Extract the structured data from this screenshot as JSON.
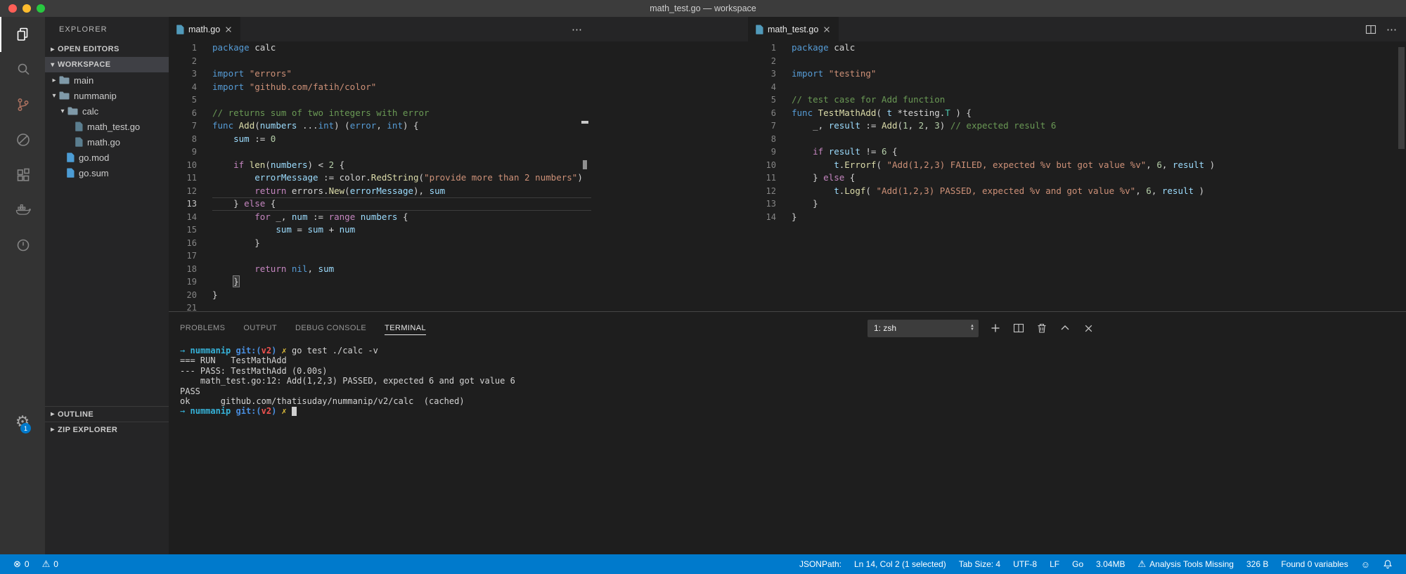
{
  "window": {
    "title": "math_test.go — workspace"
  },
  "colors": {
    "accent": "#007acc",
    "statusbar_bg": "#007acc",
    "badge_bg": "#007acc",
    "editor_bg": "#1e1e1e",
    "sidebar_bg": "#252526",
    "activitybar_bg": "#333333",
    "titlebar_bg": "#3c3c3c"
  },
  "activity_bar": {
    "items": [
      {
        "name": "explorer",
        "active": true
      },
      {
        "name": "search",
        "active": false
      },
      {
        "name": "source-control",
        "active": false,
        "tint": "#a9705f"
      },
      {
        "name": "circle-slash",
        "active": false
      },
      {
        "name": "extensions",
        "active": false
      },
      {
        "name": "docker",
        "active": false
      },
      {
        "name": "power-circle",
        "active": false
      }
    ],
    "settings_badge": "1"
  },
  "sidebar": {
    "title": "EXPLORER",
    "sections_top": [
      {
        "label": "OPEN EDITORS",
        "expanded": false,
        "selected": false
      },
      {
        "label": "WORKSPACE",
        "expanded": true,
        "selected": true
      }
    ],
    "tree": [
      {
        "label": "main",
        "kind": "folder",
        "level": 0,
        "expanded": false
      },
      {
        "label": "nummanip",
        "kind": "folder",
        "level": 0,
        "expanded": true
      },
      {
        "label": "calc",
        "kind": "folder",
        "level": 1,
        "expanded": true
      },
      {
        "label": "math_test.go",
        "kind": "file",
        "icon": "go-file",
        "level": 2
      },
      {
        "label": "math.go",
        "kind": "file",
        "icon": "go-file",
        "level": 2
      },
      {
        "label": "go.mod",
        "kind": "file",
        "icon": "mod-file",
        "level": 1
      },
      {
        "label": "go.sum",
        "kind": "file",
        "icon": "mod-file",
        "level": 1
      }
    ],
    "sections_bottom": [
      {
        "label": "OUTLINE"
      },
      {
        "label": "ZIP EXPLORER"
      }
    ]
  },
  "editors": {
    "left": {
      "tab": "math.go",
      "current_line": 13,
      "lines": [
        [
          [
            "k",
            "package"
          ],
          [
            "p",
            " calc"
          ]
        ],
        [],
        [
          [
            "k",
            "import"
          ],
          [
            "p",
            " "
          ],
          [
            "s",
            "\"errors\""
          ]
        ],
        [
          [
            "k",
            "import"
          ],
          [
            "p",
            " "
          ],
          [
            "s",
            "\"github.com/fatih/color\""
          ]
        ],
        [],
        [
          [
            "m",
            "// returns sum of two integers with error"
          ]
        ],
        [
          [
            "k",
            "func"
          ],
          [
            "p",
            " "
          ],
          [
            "f",
            "Add"
          ],
          [
            "p",
            "("
          ],
          [
            "v",
            "numbers"
          ],
          [
            "p",
            " ..."
          ],
          [
            "k",
            "int"
          ],
          [
            "p",
            ") ("
          ],
          [
            "k",
            "error"
          ],
          [
            "p",
            ", "
          ],
          [
            "k",
            "int"
          ],
          [
            "p",
            ") {"
          ]
        ],
        [
          [
            "p",
            "    "
          ],
          [
            "v",
            "sum"
          ],
          [
            "p",
            " := "
          ],
          [
            "n",
            "0"
          ]
        ],
        [],
        [
          [
            "p",
            "    "
          ],
          [
            "c",
            "if"
          ],
          [
            "p",
            " "
          ],
          [
            "f",
            "len"
          ],
          [
            "p",
            "("
          ],
          [
            "v",
            "numbers"
          ],
          [
            "p",
            ") < "
          ],
          [
            "n",
            "2"
          ],
          [
            "p",
            " {"
          ]
        ],
        [
          [
            "p",
            "        "
          ],
          [
            "v",
            "errorMessage"
          ],
          [
            "p",
            " := color."
          ],
          [
            "f",
            "RedString"
          ],
          [
            "p",
            "("
          ],
          [
            "s",
            "\"provide more than 2 numbers\""
          ],
          [
            "p",
            ")"
          ]
        ],
        [
          [
            "p",
            "        "
          ],
          [
            "c",
            "return"
          ],
          [
            "p",
            " errors."
          ],
          [
            "f",
            "New"
          ],
          [
            "p",
            "("
          ],
          [
            "v",
            "errorMessage"
          ],
          [
            "p",
            "), "
          ],
          [
            "v",
            "sum"
          ]
        ],
        [
          [
            "p",
            "    } "
          ],
          [
            "c",
            "else"
          ],
          [
            "p",
            " {"
          ]
        ],
        [
          [
            "p",
            "        "
          ],
          [
            "c",
            "for"
          ],
          [
            "p",
            " _, "
          ],
          [
            "v",
            "num"
          ],
          [
            "p",
            " := "
          ],
          [
            "c",
            "range"
          ],
          [
            "p",
            " "
          ],
          [
            "v",
            "numbers"
          ],
          [
            "p",
            " {"
          ]
        ],
        [
          [
            "p",
            "            "
          ],
          [
            "v",
            "sum"
          ],
          [
            "p",
            " = "
          ],
          [
            "v",
            "sum"
          ],
          [
            "p",
            " + "
          ],
          [
            "v",
            "num"
          ]
        ],
        [
          [
            "p",
            "        }"
          ]
        ],
        [],
        [
          [
            "p",
            "        "
          ],
          [
            "c",
            "return"
          ],
          [
            "p",
            " "
          ],
          [
            "k",
            "nil"
          ],
          [
            "p",
            ", "
          ],
          [
            "v",
            "sum"
          ]
        ],
        [
          [
            "p",
            "    "
          ],
          [
            "b",
            "}"
          ]
        ],
        [
          [
            "p",
            "}"
          ]
        ],
        []
      ]
    },
    "right": {
      "tab": "math_test.go",
      "lines": [
        [
          [
            "k",
            "package"
          ],
          [
            "p",
            " calc"
          ]
        ],
        [],
        [
          [
            "k",
            "import"
          ],
          [
            "p",
            " "
          ],
          [
            "s",
            "\"testing\""
          ]
        ],
        [],
        [
          [
            "m",
            "// test case for Add function"
          ]
        ],
        [
          [
            "k",
            "func"
          ],
          [
            "p",
            " "
          ],
          [
            "f",
            "TestMathAdd"
          ],
          [
            "p",
            "( "
          ],
          [
            "v",
            "t"
          ],
          [
            "p",
            " *testing."
          ],
          [
            "t",
            "T"
          ],
          [
            "p",
            " ) {"
          ]
        ],
        [
          [
            "p",
            "    _, "
          ],
          [
            "v",
            "result"
          ],
          [
            "p",
            " := "
          ],
          [
            "f",
            "Add"
          ],
          [
            "p",
            "("
          ],
          [
            "n",
            "1"
          ],
          [
            "p",
            ", "
          ],
          [
            "n",
            "2"
          ],
          [
            "p",
            ", "
          ],
          [
            "n",
            "3"
          ],
          [
            "p",
            ") "
          ],
          [
            "m",
            "// expected result 6"
          ]
        ],
        [],
        [
          [
            "p",
            "    "
          ],
          [
            "c",
            "if"
          ],
          [
            "p",
            " "
          ],
          [
            "v",
            "result"
          ],
          [
            "p",
            " != "
          ],
          [
            "n",
            "6"
          ],
          [
            "p",
            " {"
          ]
        ],
        [
          [
            "p",
            "        "
          ],
          [
            "v",
            "t"
          ],
          [
            "p",
            "."
          ],
          [
            "f",
            "Errorf"
          ],
          [
            "p",
            "( "
          ],
          [
            "s",
            "\"Add(1,2,3) FAILED, expected %v but got value %v\""
          ],
          [
            "p",
            ", "
          ],
          [
            "n",
            "6"
          ],
          [
            "p",
            ", "
          ],
          [
            "v",
            "result"
          ],
          [
            "p",
            " )"
          ]
        ],
        [
          [
            "p",
            "    } "
          ],
          [
            "c",
            "else"
          ],
          [
            "p",
            " {"
          ]
        ],
        [
          [
            "p",
            "        "
          ],
          [
            "v",
            "t"
          ],
          [
            "p",
            "."
          ],
          [
            "f",
            "Logf"
          ],
          [
            "p",
            "( "
          ],
          [
            "s",
            "\"Add(1,2,3) PASSED, expected %v and got value %v\""
          ],
          [
            "p",
            ", "
          ],
          [
            "n",
            "6"
          ],
          [
            "p",
            ", "
          ],
          [
            "v",
            "result"
          ],
          [
            "p",
            " )"
          ]
        ],
        [
          [
            "p",
            "    }"
          ]
        ],
        [
          [
            "p",
            "}"
          ]
        ]
      ]
    }
  },
  "panel": {
    "tabs": [
      {
        "label": "PROBLEMS",
        "active": false
      },
      {
        "label": "OUTPUT",
        "active": false
      },
      {
        "label": "DEBUG CONSOLE",
        "active": false
      },
      {
        "label": "TERMINAL",
        "active": true
      }
    ],
    "terminal_dropdown": "1: zsh",
    "actions": [
      {
        "name": "new-terminal"
      },
      {
        "name": "split-terminal"
      },
      {
        "name": "kill-terminal"
      },
      {
        "name": "maximize-panel"
      },
      {
        "name": "close-panel"
      }
    ],
    "terminal_lines": [
      [
        [
          "ta",
          "→"
        ],
        [
          "p",
          " "
        ],
        [
          "tc",
          "nummanip"
        ],
        [
          "p",
          " "
        ],
        [
          "tb",
          "git:("
        ],
        [
          "tr",
          "v2"
        ],
        [
          "tb",
          ")"
        ],
        [
          "p",
          " "
        ],
        [
          "ty",
          "✗"
        ],
        [
          "p",
          " go test ./calc -v"
        ]
      ],
      [
        [
          "p",
          "=== RUN   TestMathAdd"
        ]
      ],
      [
        [
          "p",
          "--- PASS: TestMathAdd (0.00s)"
        ]
      ],
      [
        [
          "p",
          "    math_test.go:12: Add(1,2,3) PASSED, expected 6 and got value 6"
        ]
      ],
      [
        [
          "p",
          "PASS"
        ]
      ],
      [
        [
          "p",
          "ok      github.com/thatisuday/nummanip/v2/calc  (cached)"
        ]
      ],
      [
        [
          "ta",
          "→"
        ],
        [
          "p",
          " "
        ],
        [
          "tc",
          "nummanip"
        ],
        [
          "p",
          " "
        ],
        [
          "tb",
          "git:("
        ],
        [
          "tr",
          "v2"
        ],
        [
          "tb",
          ")"
        ],
        [
          "p",
          " "
        ],
        [
          "ty",
          "✗"
        ],
        [
          "p",
          " "
        ],
        [
          "cur",
          ""
        ]
      ]
    ]
  },
  "status_bar": {
    "left": [
      {
        "icon": "error-circle",
        "text": "0"
      },
      {
        "icon": "warning",
        "text": "0"
      }
    ],
    "right": [
      {
        "text": "JSONPath:"
      },
      {
        "text": "Ln 14, Col 2 (1 selected)"
      },
      {
        "text": "Tab Size: 4"
      },
      {
        "text": "UTF-8"
      },
      {
        "text": "LF"
      },
      {
        "text": "Go"
      },
      {
        "text": "3.04MB"
      },
      {
        "icon": "warning",
        "text": "Analysis Tools Missing"
      },
      {
        "text": "326 B"
      },
      {
        "text": "Found 0 variables"
      },
      {
        "icon": "smiley",
        "text": ""
      },
      {
        "icon": "bell",
        "text": ""
      }
    ]
  }
}
